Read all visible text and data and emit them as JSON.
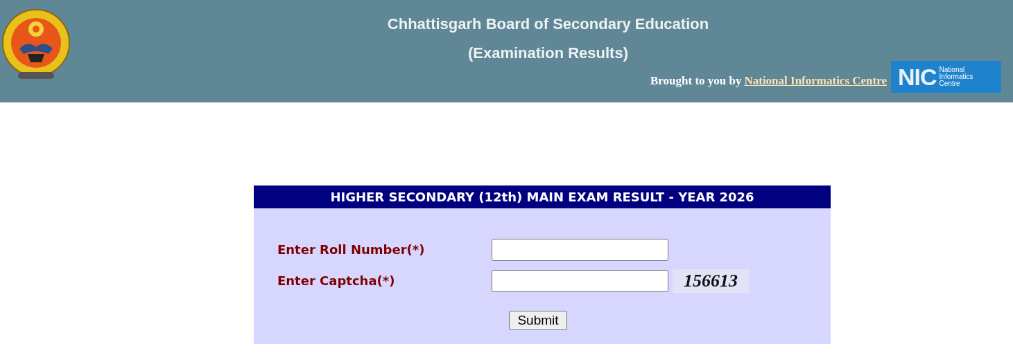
{
  "header": {
    "title": "Chhattisgarh Board of Secondary Education",
    "subtitle": "(Examination Results)",
    "credit_text": "Brought to you by",
    "credit_link": "National Informatics Centre",
    "nic_logo": {
      "short": "NIC",
      "lines": [
        "National",
        "Informatics",
        "Centre"
      ]
    }
  },
  "form": {
    "title": "HIGHER SECONDARY (12th) MAIN EXAM RESULT - YEAR 2026",
    "fields": [
      {
        "label": "Enter Roll Number(*)",
        "kind": "text"
      },
      {
        "label": "Enter Captcha(*)",
        "kind": "captcha",
        "captcha": "156613"
      }
    ],
    "submit": "Submit"
  }
}
